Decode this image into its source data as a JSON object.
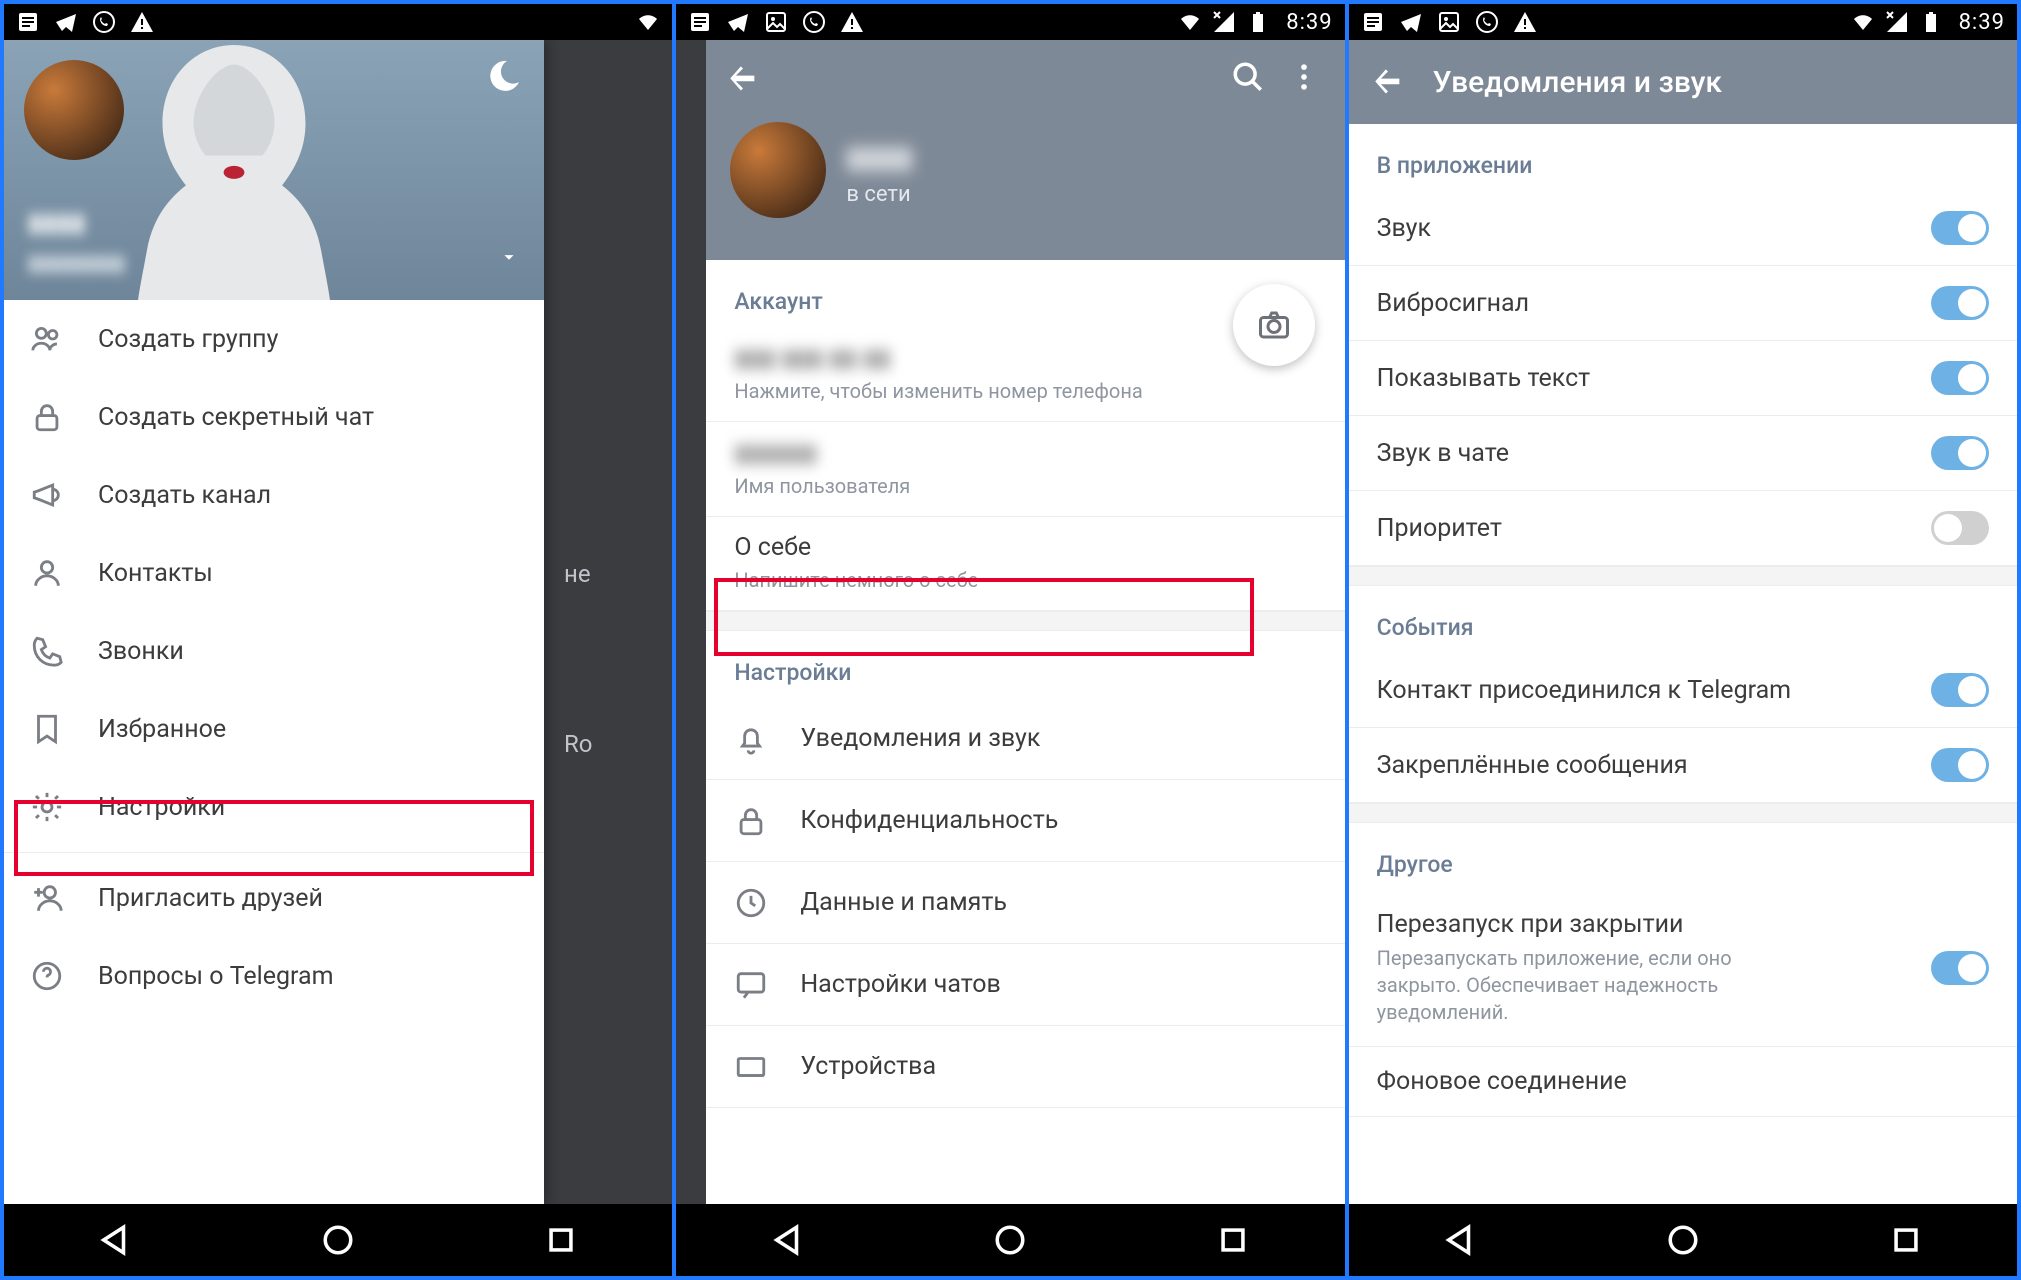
{
  "status": {
    "clock": "8:39"
  },
  "screen1": {
    "peek_top": "не",
    "peek_bottom": "Ro",
    "profile": {
      "name": "▮▮▮▮",
      "handle": "▮▮▮▮▮▮▮▮"
    },
    "items": [
      {
        "icon": "group",
        "label": "Создать группу"
      },
      {
        "icon": "lock",
        "label": "Создать секретный чат"
      },
      {
        "icon": "megaphone",
        "label": "Создать канал"
      },
      {
        "icon": "person",
        "label": "Контакты"
      },
      {
        "icon": "phone",
        "label": "Звонки"
      },
      {
        "icon": "bookmark",
        "label": "Избранное"
      },
      {
        "icon": "gear",
        "label": "Настройки"
      },
      {
        "icon": "adduser",
        "label": "Пригласить друзей"
      },
      {
        "icon": "help",
        "label": "Вопросы о Telegram"
      }
    ]
  },
  "screen2": {
    "profile": {
      "name": "▮▮▮▮",
      "status": "в сети"
    },
    "account": {
      "title": "Аккаунт",
      "phone": {
        "value": "▮▮▮ ▮▮▮ ▮▮ ▮▮",
        "hint": "Нажмите, чтобы изменить номер телефона"
      },
      "username": {
        "value": "▮▮▮▮▮▮",
        "hint": "Имя пользователя"
      },
      "bio": {
        "value": "О себе",
        "hint": "Напишите немного о себе"
      }
    },
    "settings": {
      "title": "Настройки",
      "rows": [
        {
          "icon": "bell",
          "label": "Уведомления и звук"
        },
        {
          "icon": "lock",
          "label": "Конфиденциальность"
        },
        {
          "icon": "data",
          "label": "Данные и память"
        },
        {
          "icon": "chat",
          "label": "Настройки чатов"
        },
        {
          "icon": "devices",
          "label": "Устройства"
        }
      ]
    }
  },
  "screen3": {
    "title": "Уведомления и звук",
    "groups": [
      {
        "title": "В приложении",
        "rows": [
          {
            "label": "Звук",
            "on": true
          },
          {
            "label": "Вибросигнал",
            "on": true
          },
          {
            "label": "Показывать текст",
            "on": true
          },
          {
            "label": "Звук в чате",
            "on": true
          },
          {
            "label": "Приоритет",
            "on": false
          }
        ]
      },
      {
        "title": "События",
        "rows": [
          {
            "label": "Контакт присоединился к Telegram",
            "on": true
          },
          {
            "label": "Закреплённые сообщения",
            "on": true
          }
        ]
      },
      {
        "title": "Другое",
        "rows": [
          {
            "label": "Перезапуск при закрытии",
            "desc": "Перезапускать приложение, если оно закрыто. Обеспечивает надежность уведомлений.",
            "on": true
          },
          {
            "label": "Фоновое соединение"
          }
        ]
      }
    ]
  }
}
